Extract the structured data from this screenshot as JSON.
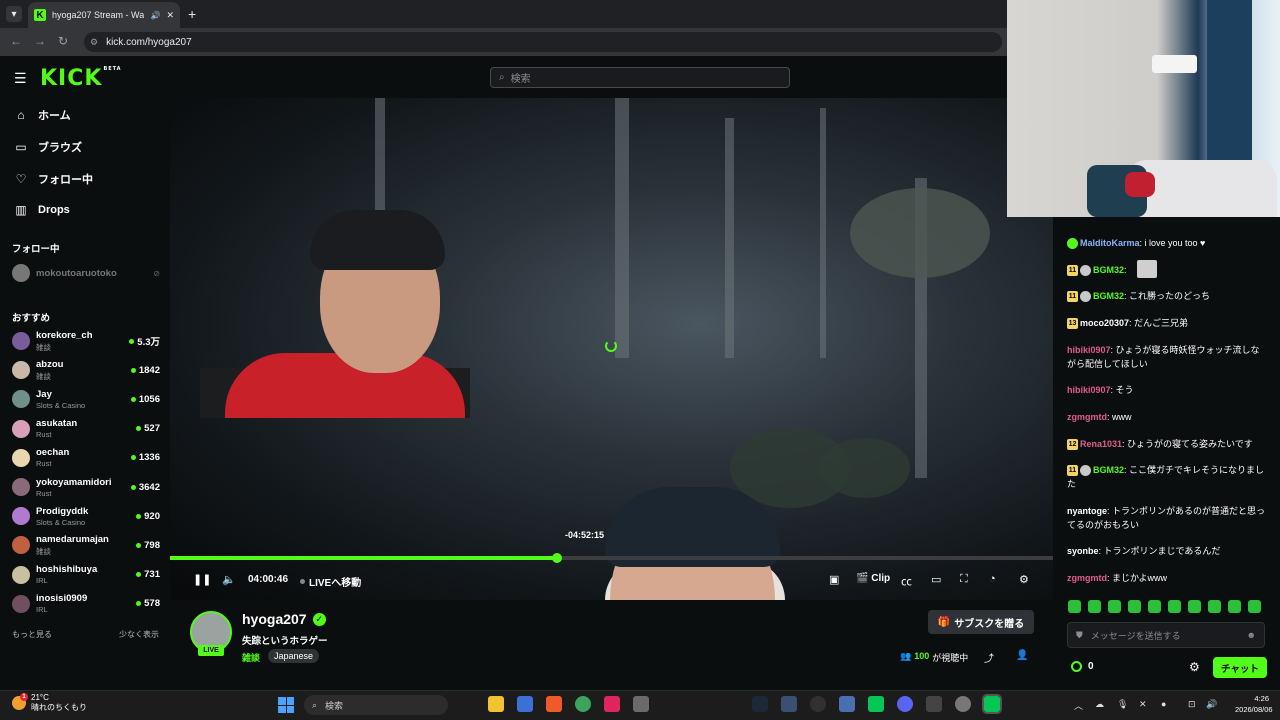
{
  "browser": {
    "tab_title": "hyoga207 Stream - Watch L",
    "tab_close": "✕",
    "new_tab": "+",
    "url": "kick.com/hyoga207"
  },
  "header": {
    "logo": "KICK",
    "logo_beta": "BETA",
    "search_placeholder": "検索"
  },
  "sidebar": {
    "nav": [
      {
        "label": "ホーム",
        "icon": "home-icon"
      },
      {
        "label": "ブラウズ",
        "icon": "browse-icon"
      },
      {
        "label": "フォロー中",
        "icon": "heart-icon"
      },
      {
        "label": "Drops",
        "icon": "drops-icon"
      }
    ],
    "following_title": "フォロー中",
    "following": [
      {
        "name": "mokoutoaruotoko"
      }
    ],
    "recommended_title": "おすすめ",
    "recommended": [
      {
        "name": "korekore_ch",
        "category": "雑談",
        "viewers": "5.3万",
        "color": "#7a5c9a"
      },
      {
        "name": "abzou",
        "category": "雑談",
        "viewers": "1842",
        "color": "#c9b8a8"
      },
      {
        "name": "Jay",
        "category": "Slots & Casino",
        "viewers": "1056",
        "color": "#6f8f8a"
      },
      {
        "name": "asukatan",
        "category": "Rust",
        "viewers": "527",
        "color": "#d8a0b8"
      },
      {
        "name": "oechan",
        "category": "Rust",
        "viewers": "1336",
        "color": "#e8d6b0"
      },
      {
        "name": "yokoyamamidori",
        "category": "Rust",
        "viewers": "3642",
        "color": "#8a6a7a"
      },
      {
        "name": "Prodigyddk",
        "category": "Slots & Casino",
        "viewers": "920",
        "color": "#b07ad0"
      },
      {
        "name": "namedarumajan",
        "category": "雑談",
        "viewers": "798",
        "color": "#c06040"
      },
      {
        "name": "hoshishibuya",
        "category": "IRL",
        "viewers": "731",
        "color": "#c8c0a0"
      },
      {
        "name": "inosisi0909",
        "category": "IRL",
        "viewers": "578",
        "color": "#705060"
      }
    ],
    "show_more": "もっと見る",
    "show_less": "少なく表示"
  },
  "player": {
    "seek_tooltip": "-04:52:15",
    "time": "04:00:46",
    "go_live": "LIVEへ移動",
    "clip_label": "Clip",
    "progress_fraction": 0.438
  },
  "stream": {
    "channel": "hyoga207",
    "live_badge": "LIVE",
    "title": "失踪というホラゲー",
    "category": "雑談",
    "tag": "Japanese",
    "subscribe_gift": "サブスクを贈る",
    "viewer_count": "100",
    "viewer_suffix": "が視聴中"
  },
  "chat": {
    "messages": [
      {
        "user": "MalditoKarma",
        "color": "#8ab4f8",
        "text": ": i love you too ♥",
        "badges": [
          "verified"
        ]
      },
      {
        "user": "BGM32",
        "color": "#53fc18",
        "text": ":",
        "badges": [
          "11",
          "icon"
        ]
      },
      {
        "user": "BGM32",
        "color": "#53fc18",
        "text": ": これ勝ったのどっち",
        "badges": [
          "11",
          "icon"
        ]
      },
      {
        "user": "moco20307",
        "color": "#ffffff",
        "text": ": だんご三兄弟",
        "badges": [
          "13"
        ]
      },
      {
        "user": "hibiki0907",
        "color": "#e05d8a",
        "text": ": ひょうが寝る時妖怪ウォッチ流しながら配信してほしい",
        "badges": []
      },
      {
        "user": "hibiki0907",
        "color": "#e05d8a",
        "text": ": そう",
        "badges": []
      },
      {
        "user": "zgmgmtd",
        "color": "#e05d8a",
        "text": ": www",
        "badges": []
      },
      {
        "user": "Rena1031",
        "color": "#e05d8a",
        "text": ": ひょうがの寝てる姿みたいです",
        "badges": [
          "12"
        ]
      },
      {
        "user": "BGM32",
        "color": "#53fc18",
        "text": ": ここ僕ガチでキレそうになりました",
        "badges": [
          "11",
          "icon"
        ]
      },
      {
        "user": "nyantoge",
        "color": "#ffffff",
        "text": ": トランポリンがあるのが普通だと思ってるのがおもろい",
        "badges": []
      },
      {
        "user": "syonbe",
        "color": "#ffffff",
        "text": ": トランポリンまじであるんだ",
        "badges": []
      },
      {
        "user": "zgmgmtd",
        "color": "#e05d8a",
        "text": ": まじかよwww",
        "badges": []
      }
    ],
    "input_placeholder": "メッセージを送信する",
    "points": "0",
    "send_label": "チャット"
  },
  "taskbar": {
    "temp": "21°C",
    "weather": "晴れのちくもり",
    "notification_count": "1",
    "search": "検索",
    "time": "4:26",
    "date": "2026/08/06"
  },
  "colors": {
    "brand": "#53fc18",
    "background": "#0b0e0f"
  }
}
